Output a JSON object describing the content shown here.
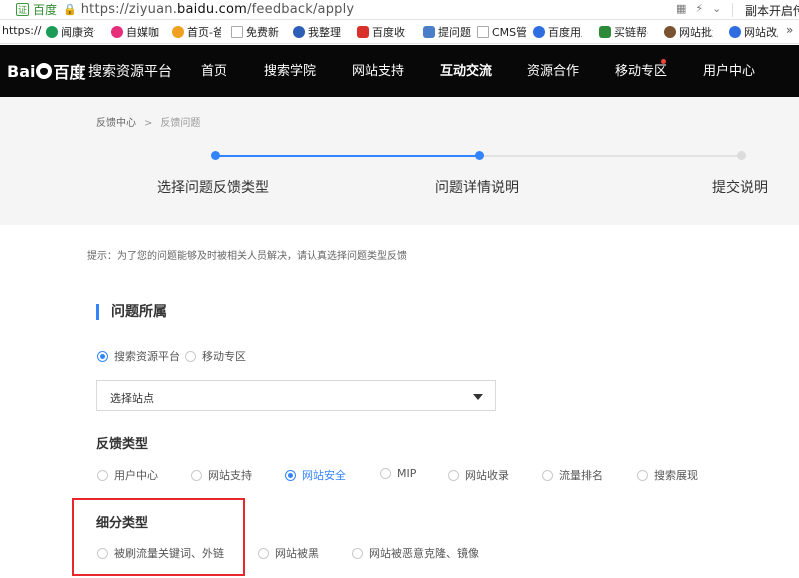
{
  "browser": {
    "site_label": "百度",
    "cert_label": "证",
    "url_scheme": "https://",
    "url_sub": "ziyuan.",
    "url_domain": "baidu.com",
    "url_path": "/feedback/apply",
    "right_text": "副本开启传"
  },
  "bookmarks": [
    {
      "label": "https://",
      "color": "#ffffff"
    },
    {
      "label": "闻康资讯",
      "color": "#1a9b57"
    },
    {
      "label": "自媒咖",
      "color": "#e62e7a"
    },
    {
      "label": "首页-爸",
      "color": "#f0a020"
    },
    {
      "label": "免费新闻",
      "color": "#bbbbbb"
    },
    {
      "label": "我整理了",
      "color": "#2c5fb5"
    },
    {
      "label": "百度收录",
      "color": "#d9312a"
    },
    {
      "label": "提问题",
      "color": "#4a7ec9"
    },
    {
      "label": "CMS管",
      "color": "#bbbbbb"
    },
    {
      "label": "百度用户",
      "color": "#2f6ee0"
    },
    {
      "label": "买链帮手",
      "color": "#2d8a3a"
    },
    {
      "label": "网站批量",
      "color": "#7a5230"
    },
    {
      "label": "网站改版",
      "color": "#2f6ee0"
    }
  ],
  "nav": {
    "logo_text_1": "Bai",
    "logo_text_2": "百度",
    "platform": "搜索资源平台",
    "items": [
      {
        "label": "首页"
      },
      {
        "label": "搜索学院"
      },
      {
        "label": "网站支持"
      },
      {
        "label": "互动交流"
      },
      {
        "label": "资源合作"
      },
      {
        "label": "移动专区"
      },
      {
        "label": "用户中心"
      }
    ]
  },
  "breadcrumb": {
    "root": "反馈中心",
    "separator": ">",
    "current": "反馈问题"
  },
  "steps": [
    {
      "label": "选择问题反馈类型"
    },
    {
      "label": "问题详情说明"
    },
    {
      "label": "提交说明"
    }
  ],
  "colors": {
    "accent": "#3385ff",
    "highlight": "#e8262b"
  },
  "tip": "提示：为了您的问题能够及时被相关人员解决，请认真选择问题类型反馈",
  "section_title": "问题所属",
  "belong_options": [
    {
      "label": "搜索资源平台",
      "selected": true
    },
    {
      "label": "移动专区",
      "selected": false
    }
  ],
  "site_select": {
    "value": "选择站点"
  },
  "feedback_type_label": "反馈类型",
  "feedback_types": [
    {
      "label": "用户中心",
      "selected": false
    },
    {
      "label": "网站支持",
      "selected": false
    },
    {
      "label": "网站安全",
      "selected": true
    },
    {
      "label": "MIP",
      "selected": false
    },
    {
      "label": "网站收录",
      "selected": false
    },
    {
      "label": "流量排名",
      "selected": false
    },
    {
      "label": "搜索展现",
      "selected": false
    }
  ],
  "subtype_label": "细分类型",
  "subtypes": [
    {
      "label": "被刷流量关键词、外链",
      "selected": false
    },
    {
      "label": "网站被黑",
      "selected": false
    },
    {
      "label": "网站被恶意克隆、镜像",
      "selected": false
    }
  ]
}
